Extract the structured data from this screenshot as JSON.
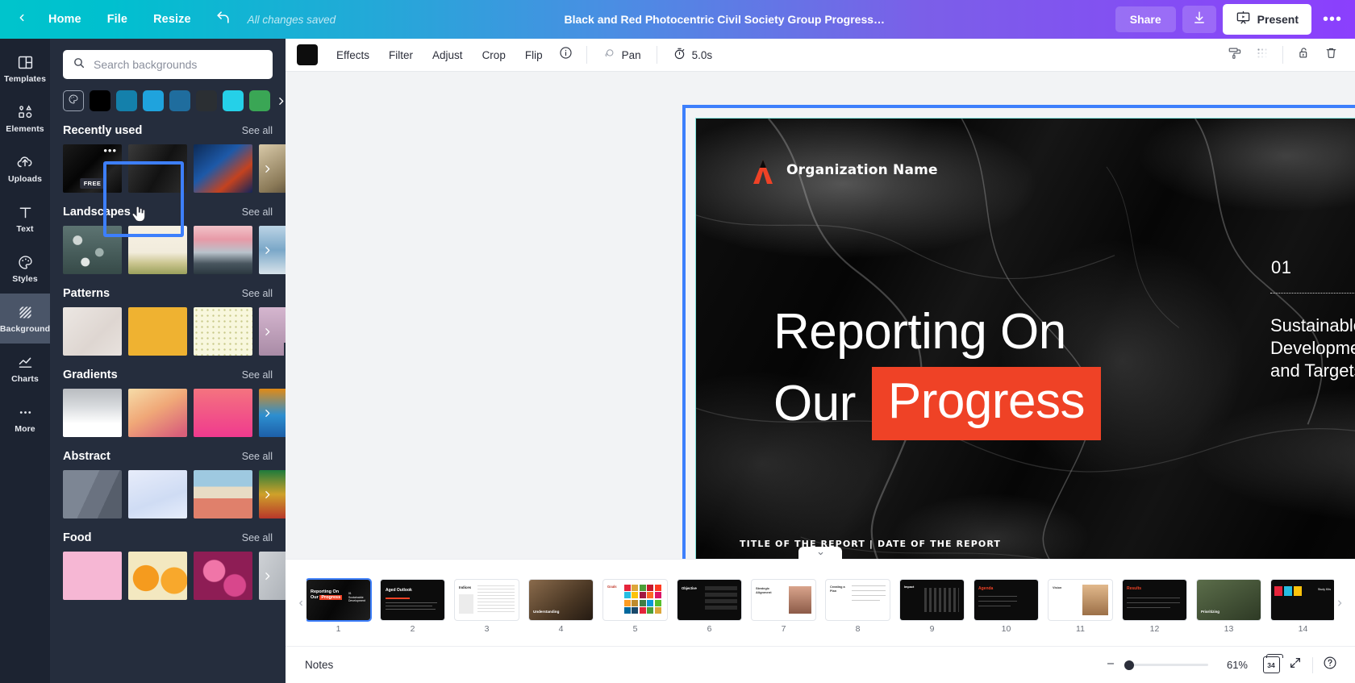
{
  "topbar": {
    "back_icon": "chevron-left-icon",
    "home_label": "Home",
    "file_label": "File",
    "resize_label": "Resize",
    "undo_icon": "undo-arrow-icon",
    "saved_status": "All changes saved",
    "doc_title": "Black and Red Photocentric Civil Society Group Progress Re...",
    "share_label": "Share",
    "download_icon": "download-icon",
    "present_label": "Present",
    "present_icon": "presentation-screen-icon",
    "more_label": "•••"
  },
  "rail": {
    "items": [
      {
        "label": "Templates",
        "icon": "templates-grid-icon",
        "active": false
      },
      {
        "label": "Elements",
        "icon": "elements-shapes-icon",
        "active": false
      },
      {
        "label": "Uploads",
        "icon": "upload-cloud-icon",
        "active": false
      },
      {
        "label": "Text",
        "icon": "text-t-icon",
        "active": false
      },
      {
        "label": "Styles",
        "icon": "styles-palette-icon",
        "active": false
      },
      {
        "label": "Background",
        "icon": "background-hatch-icon",
        "active": true
      },
      {
        "label": "Charts",
        "icon": "charts-line-icon",
        "active": false
      },
      {
        "label": "More",
        "icon": "more-dots-icon",
        "active": false
      }
    ]
  },
  "panel": {
    "search_placeholder": "Search backgrounds",
    "search_value": "",
    "search_icon": "search-icon",
    "color_picker_icon": "color-wheel-icon",
    "swatch_colors": [
      "#000000",
      "#1480ab",
      "#1fa3dd",
      "#1f6d9e",
      "#2b2f33",
      "#25d0e8",
      "#3aa655"
    ],
    "swatch_next_icon": "chevron-right-icon",
    "see_all_label": "See all",
    "sections": [
      {
        "title": "Recently used",
        "selected_index": 0
      },
      {
        "title": "Landscapes",
        "selected_index": -1
      },
      {
        "title": "Patterns",
        "selected_index": -1
      },
      {
        "title": "Gradients",
        "selected_index": -1
      },
      {
        "title": "Abstract",
        "selected_index": -1
      },
      {
        "title": "Food",
        "selected_index": -1
      }
    ],
    "free_badge": "FREE",
    "thumb_menu_icon": "more-dots-icon",
    "collapse_icon": "chevron-left-icon",
    "cursor_icon": "pointing-hand-cursor"
  },
  "canvas_toolbar": {
    "color_swatch": "#0d0d0d",
    "effects_label": "Effects",
    "filter_label": "Filter",
    "adjust_label": "Adjust",
    "crop_label": "Crop",
    "flip_label": "Flip",
    "info_icon": "info-circle-icon",
    "pan_label": "Pan",
    "pan_icon": "pan-hand-icon",
    "timer_label": "5.0s",
    "timer_icon": "stopwatch-icon",
    "paint_icon": "paint-roller-icon",
    "transparency_icon": "transparency-grid-icon",
    "lock_icon": "lock-open-icon",
    "delete_icon": "trash-icon"
  },
  "slide": {
    "organization": "Organization Name",
    "logo_icon": "organization-logo-icon",
    "headline_line1": "Reporting On",
    "headline_line2_plain": "Our",
    "headline_line2_highlight": "Progress",
    "highlight_color": "#ef4226",
    "number": "01",
    "subtitle": "Sustainable Development Goals and Targets",
    "footer": "TITLE OF THE REPORT  |  DATE OF THE REPORT",
    "rotate_icon": "rotate-handle-icon",
    "selection_color": "#3d7ffc"
  },
  "filmstrip": {
    "prev_icon": "chevron-left-icon",
    "next_icon": "chevron-right-icon",
    "collapse_icon": "chevron-down-icon",
    "selected_page": 1,
    "pages": [
      {
        "num": "1"
      },
      {
        "num": "2"
      },
      {
        "num": "3"
      },
      {
        "num": "4"
      },
      {
        "num": "5"
      },
      {
        "num": "6"
      },
      {
        "num": "7"
      },
      {
        "num": "8"
      },
      {
        "num": "9"
      },
      {
        "num": "10"
      },
      {
        "num": "11"
      },
      {
        "num": "12"
      },
      {
        "num": "13"
      },
      {
        "num": "14"
      }
    ]
  },
  "notesbar": {
    "notes_label": "Notes",
    "zoom_minus_icon": "minus-icon",
    "zoom_percent": "61%",
    "page_count": "34",
    "page_count_icon": "page-count-icon",
    "fullscreen_icon": "expand-arrows-icon",
    "help_icon": "help-circle-icon"
  }
}
